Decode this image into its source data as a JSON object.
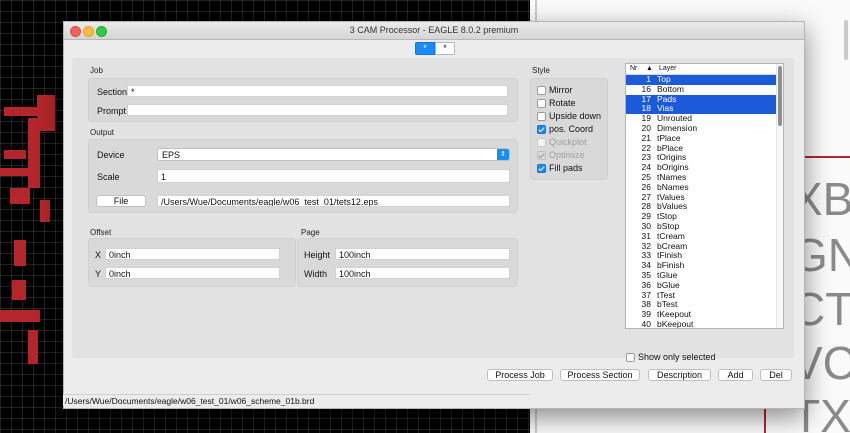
{
  "window": {
    "title": "3 CAM Processor - EAGLE 8.0.2 premium",
    "tabs": [
      {
        "label": "*",
        "active": true
      },
      {
        "label": "*",
        "active": false
      }
    ]
  },
  "job": {
    "group_label": "Job",
    "section_label": "Section",
    "section_value": "*",
    "prompt_label": "Prompt",
    "prompt_value": ""
  },
  "output": {
    "group_label": "Output",
    "device_label": "Device",
    "device_value": "EPS",
    "scale_label": "Scale",
    "scale_value": "1",
    "file_button": "File",
    "file_value": "/Users/Wue/Documents/eagle/w06_test_01/tets12.eps"
  },
  "offset": {
    "group_label": "Offset",
    "x_label": "X",
    "x_value": "0inch",
    "y_label": "Y",
    "y_value": "0inch"
  },
  "page": {
    "group_label": "Page",
    "height_label": "Height",
    "height_value": "100inch",
    "width_label": "Width",
    "width_value": "100inch"
  },
  "style": {
    "group_label": "Style",
    "options": [
      {
        "label": "Mirror",
        "checked": false,
        "enabled": true
      },
      {
        "label": "Rotate",
        "checked": false,
        "enabled": true
      },
      {
        "label": "Upside down",
        "checked": false,
        "enabled": true
      },
      {
        "label": "pos. Coord",
        "checked": true,
        "enabled": true
      },
      {
        "label": "Quickplot",
        "checked": false,
        "enabled": false
      },
      {
        "label": "Optimize",
        "checked": true,
        "enabled": false
      },
      {
        "label": "Fill pads",
        "checked": true,
        "enabled": true
      }
    ]
  },
  "layers": {
    "header_nr": "Nr",
    "header_sort_icon": "sort-up-icon",
    "header_layer": "Layer",
    "rows": [
      {
        "nr": "1",
        "name": "Top",
        "selected": true
      },
      {
        "nr": "16",
        "name": "Bottom",
        "selected": false
      },
      {
        "nr": "17",
        "name": "Pads",
        "selected": true
      },
      {
        "nr": "18",
        "name": "Vias",
        "selected": true
      },
      {
        "nr": "19",
        "name": "Unrouted",
        "selected": false
      },
      {
        "nr": "20",
        "name": "Dimension",
        "selected": false
      },
      {
        "nr": "21",
        "name": "tPlace",
        "selected": false
      },
      {
        "nr": "22",
        "name": "bPlace",
        "selected": false
      },
      {
        "nr": "23",
        "name": "tOrigins",
        "selected": false
      },
      {
        "nr": "24",
        "name": "bOrigins",
        "selected": false
      },
      {
        "nr": "25",
        "name": "tNames",
        "selected": false
      },
      {
        "nr": "26",
        "name": "bNames",
        "selected": false
      },
      {
        "nr": "27",
        "name": "tValues",
        "selected": false
      },
      {
        "nr": "28",
        "name": "bValues",
        "selected": false
      },
      {
        "nr": "29",
        "name": "tStop",
        "selected": false
      },
      {
        "nr": "30",
        "name": "bStop",
        "selected": false
      },
      {
        "nr": "31",
        "name": "tCream",
        "selected": false
      },
      {
        "nr": "32",
        "name": "bCream",
        "selected": false
      },
      {
        "nr": "33",
        "name": "tFinish",
        "selected": false
      },
      {
        "nr": "34",
        "name": "bFinish",
        "selected": false
      },
      {
        "nr": "35",
        "name": "tGlue",
        "selected": false
      },
      {
        "nr": "36",
        "name": "bGlue",
        "selected": false
      },
      {
        "nr": "37",
        "name": "tTest",
        "selected": false
      },
      {
        "nr": "38",
        "name": "bTest",
        "selected": false
      },
      {
        "nr": "39",
        "name": "tKeepout",
        "selected": false
      },
      {
        "nr": "40",
        "name": "bKeepout",
        "selected": false
      }
    ],
    "show_only_selected_label": "Show only selected",
    "show_only_selected_checked": false
  },
  "buttons": {
    "process_job": "Process Job",
    "process_section": "Process Section",
    "description": "Description",
    "add": "Add",
    "del": "Del"
  },
  "status_bar": {
    "path": "/Users/Wue/Documents/eagle/w06_test_01/w06_scheme_01b.brd"
  },
  "background": {
    "schematic_letters": [
      "XB",
      "GN",
      "CT",
      "VC",
      "TX"
    ]
  },
  "colors": {
    "accent": "#1a8bf3",
    "selection": "#1c5bd8",
    "pcb_trace": "#b3262b",
    "pcb_background": "#000000"
  }
}
